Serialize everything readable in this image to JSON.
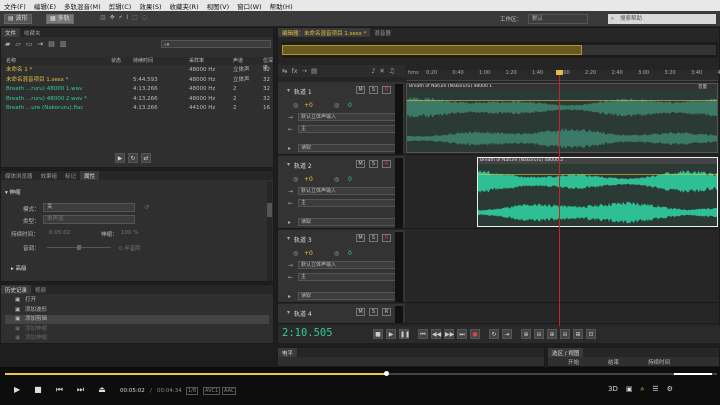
{
  "menu": [
    "文件(F)",
    "编辑(E)",
    "多轨混音(M)",
    "剪辑(C)",
    "效果(S)",
    "收藏夹(R)",
    "视图(V)",
    "窗口(W)",
    "帮助(H)"
  ],
  "toolbar": {
    "waveform": "波形",
    "multitrack": "多轨",
    "workspace_label": "工作区：",
    "workspace_value": "默认",
    "search_placeholder": "搜索帮助"
  },
  "files_panel": {
    "tabs": [
      "文件",
      "收藏夹"
    ],
    "columns": [
      "名称",
      "状态",
      "持续时间",
      "采样率",
      "声道",
      "位深度"
    ],
    "rows": [
      {
        "name": "未命名 1 *",
        "status": "",
        "duration": "",
        "rate": "48000 Hz",
        "ch": "立体声",
        "bits": "32",
        "color": "#e0c040"
      },
      {
        "name": "未命名混音项目 1.sesx *",
        "status": "",
        "duration": "5:44.593",
        "rate": "48000 Hz",
        "ch": "立体声",
        "bits": "32",
        "color": "#e0c040"
      },
      {
        "name": "Breath ...ruru) 48000 1.wav",
        "status": "",
        "duration": "4:13.266",
        "rate": "48000 Hz",
        "ch": "2",
        "bits": "32",
        "color": "#2ecc9a"
      },
      {
        "name": "Breath ...ruru) 48000 2.wav *",
        "status": "",
        "duration": "4:13.266",
        "rate": "48000 Hz",
        "ch": "2",
        "bits": "32",
        "color": "#2ecc9a"
      },
      {
        "name": "Breath ...ure (Nakoruru).flac",
        "status": "",
        "duration": "4:13.266",
        "rate": "44100 Hz",
        "ch": "2",
        "bits": "16",
        "color": "#2ecc9a"
      }
    ]
  },
  "props_panel": {
    "tabs": [
      "媒体浏览器",
      "效果组",
      "标记",
      "属性"
    ],
    "section": "伸缩",
    "mode_label": "模式：",
    "mode_value": "关",
    "type_label": "类型：",
    "type_value": "单声道",
    "duration_label": "持续时间：",
    "duration_value": "0:05:02",
    "stretch_label": "伸缩：",
    "stretch_value": "100 %",
    "pitch_label": "音调：",
    "pitch_value": "0 半音阶",
    "advanced": "高级"
  },
  "history_panel": {
    "tabs": [
      "历史记录",
      "视频"
    ],
    "items": [
      "打开",
      "添加波形",
      "添加剪辑",
      "添加伸缩",
      "添加伸缩"
    ]
  },
  "editor": {
    "tabs": [
      "编辑器：未命名混音项目 1.sesx *",
      "混音器"
    ],
    "ruler_unit": "hms",
    "ticks": [
      "0:20",
      "0:40",
      "1:00",
      "1:20",
      "1:40",
      "2:00",
      "2:20",
      "2:40",
      "3:00",
      "3:20",
      "3:40",
      "4:00"
    ],
    "tracks": [
      {
        "name": "轨道 1",
        "vol": "+0",
        "input": "默认立体声输入",
        "output": "主",
        "mode": "读取",
        "clip": "Breath of Nature (Nakoruru) 48000 1",
        "clip_color": "#3a7a66"
      },
      {
        "name": "轨道 2",
        "vol": "+0",
        "input": "默认立体声输入",
        "output": "主",
        "mode": "读取",
        "clip": "Breath of Nature (Nakoruru) 48000 2",
        "clip_color": "#2fbf94"
      },
      {
        "name": "轨道 3",
        "vol": "+0",
        "input": "默认立体声输入",
        "output": "主",
        "mode": "读取",
        "clip": "",
        "clip_color": ""
      },
      {
        "name": "轨道 4",
        "vol": "",
        "input": "",
        "output": "",
        "mode": "",
        "clip": "",
        "clip_color": ""
      }
    ],
    "track_btns": [
      "M",
      "S",
      "R"
    ],
    "timecode": "2:10.505",
    "clip_gain_label": "音量"
  },
  "bottom": {
    "level_tab": "电平",
    "sel_tab": "选区 / 视图",
    "sel_cols": [
      "开始",
      "结束",
      "持续时间"
    ]
  },
  "player": {
    "time": "00:05:02",
    "total": "00:04:34",
    "badge1": "1/8",
    "badge2": "AVC1",
    "badge3": "AAC",
    "progress": 0.535
  },
  "colors": {
    "accent": "#2ecc9a",
    "selected": "#e0c040",
    "playhead": "#cc2222"
  }
}
